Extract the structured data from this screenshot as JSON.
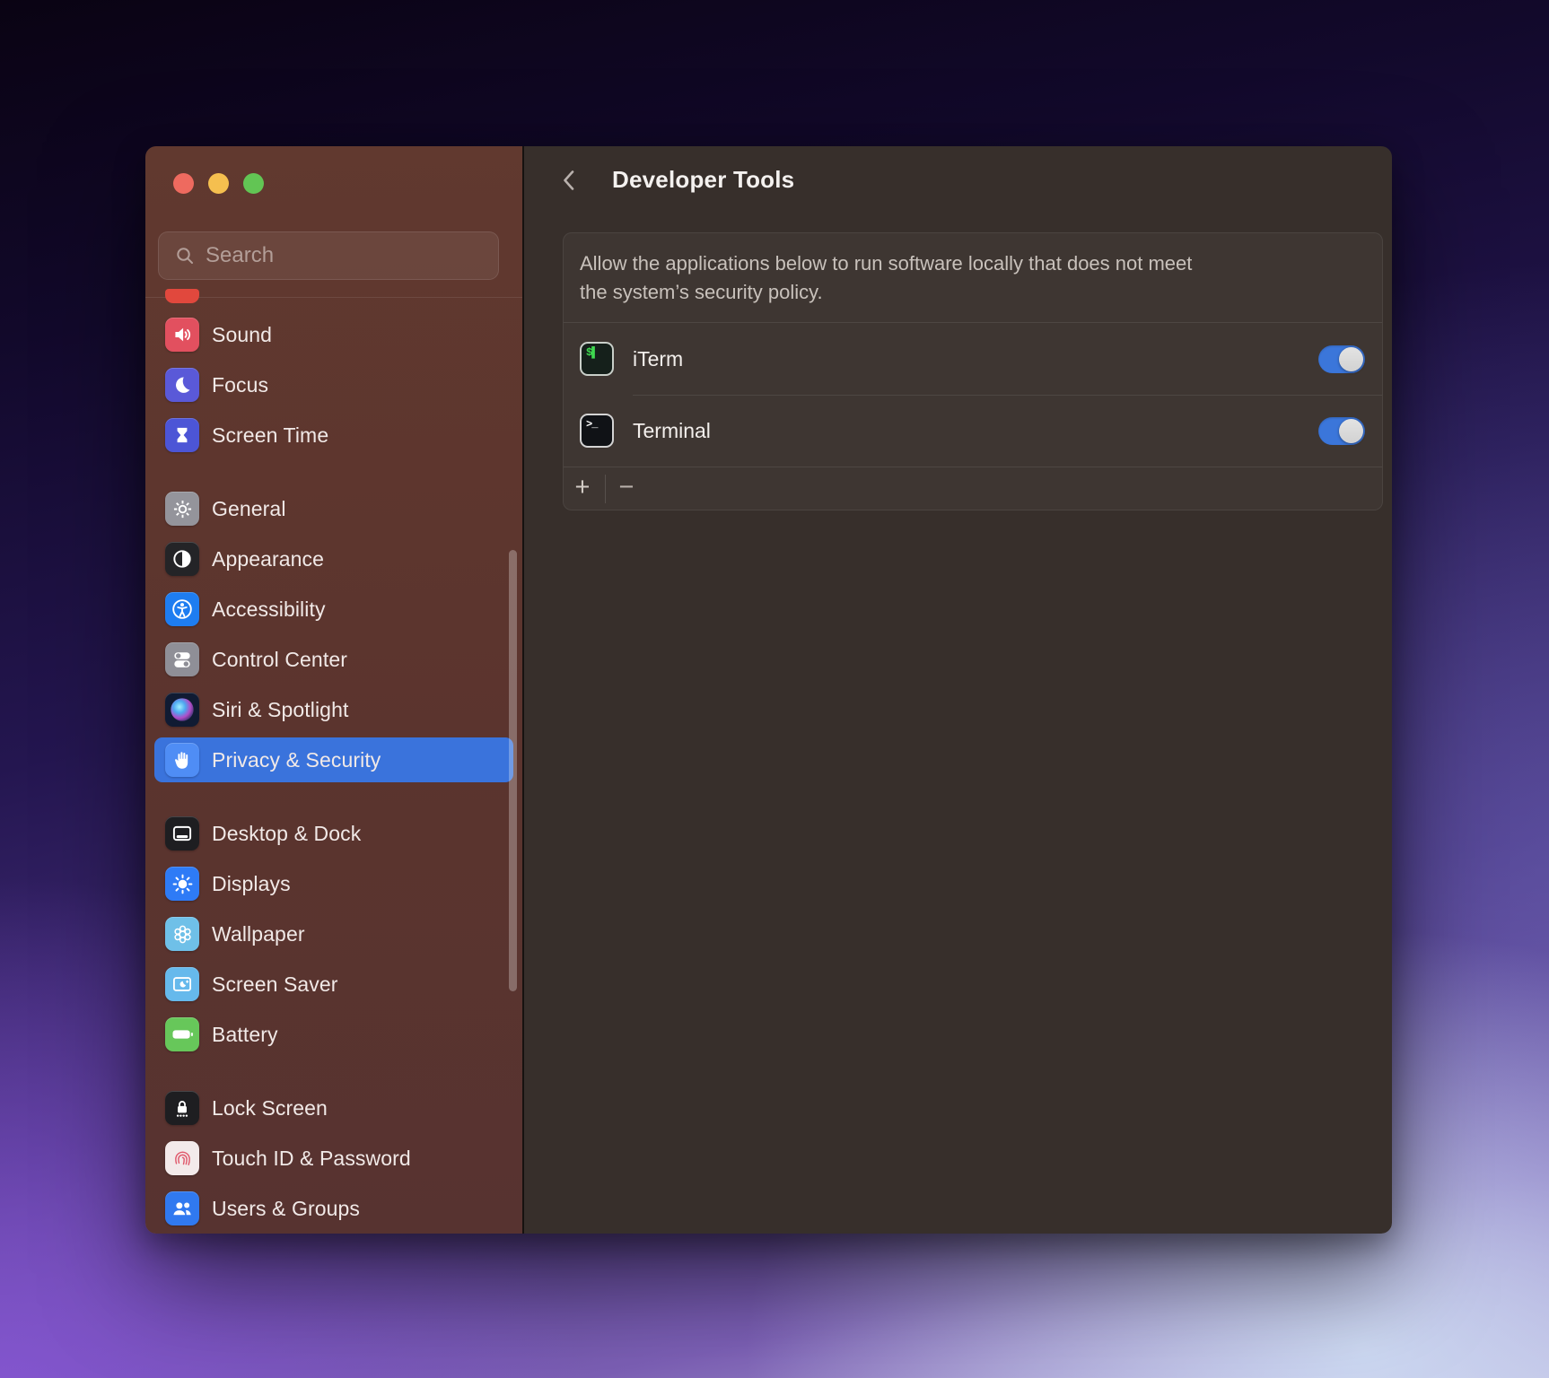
{
  "window": {
    "controls": [
      {
        "name": "close",
        "color": "#ee6a5f"
      },
      {
        "name": "minimize",
        "color": "#f5bf4f"
      },
      {
        "name": "zoom",
        "color": "#62c554"
      }
    ],
    "sidebar": {
      "search_placeholder": "Search",
      "clipped_item": {
        "icon": "notifications-icon",
        "color": "#e1483d"
      },
      "groups": [
        {
          "items": [
            {
              "label": "Sound",
              "icon": "sound-icon",
              "color": "#e2505f"
            },
            {
              "label": "Focus",
              "icon": "focus-icon",
              "color": "#5a59d8"
            },
            {
              "label": "Screen Time",
              "icon": "screen-time-icon",
              "color": "#4c55d6"
            }
          ]
        },
        {
          "items": [
            {
              "label": "General",
              "icon": "general-icon",
              "color": "#94949b"
            },
            {
              "label": "Appearance",
              "icon": "appearance-icon",
              "color": "#242427"
            },
            {
              "label": "Accessibility",
              "icon": "accessibility-icon",
              "color": "#1e7df1"
            },
            {
              "label": "Control Center",
              "icon": "control-center-icon",
              "color": "#8f8f97"
            },
            {
              "label": "Siri & Spotlight",
              "icon": "siri-icon",
              "color": "#101b33"
            },
            {
              "label": "Privacy & Security",
              "icon": "privacy-icon",
              "color": "#4f8df5",
              "selected": true
            }
          ]
        },
        {
          "items": [
            {
              "label": "Desktop & Dock",
              "icon": "desktop-dock-icon",
              "color": "#1e1e21"
            },
            {
              "label": "Displays",
              "icon": "displays-icon",
              "color": "#2e7bf6"
            },
            {
              "label": "Wallpaper",
              "icon": "wallpaper-icon",
              "color": "#6fc0e8"
            },
            {
              "label": "Screen Saver",
              "icon": "screen-saver-icon",
              "color": "#66b9ec"
            },
            {
              "label": "Battery",
              "icon": "battery-icon",
              "color": "#67c75a"
            }
          ]
        },
        {
          "items": [
            {
              "label": "Lock Screen",
              "icon": "lock-screen-icon",
              "color": "#1e1e21"
            },
            {
              "label": "Touch ID & Password",
              "icon": "touch-id-icon",
              "color": "#f3eaea"
            },
            {
              "label": "Users & Groups",
              "icon": "users-groups-icon",
              "color": "#3079f0"
            }
          ]
        }
      ]
    },
    "panel": {
      "title": "Developer Tools",
      "description_lines": [
        "Allow the applications below to run software locally that does not meet",
        "the system’s security policy."
      ],
      "apps": [
        {
          "name": "iTerm",
          "icon": "iterm-icon",
          "enabled": true
        },
        {
          "name": "Terminal",
          "icon": "terminal-icon",
          "enabled": true
        }
      ],
      "add_label": "+",
      "remove_label": "−"
    },
    "accent_color": "#3a73dc",
    "toggle_on_color": "#3b76da"
  }
}
